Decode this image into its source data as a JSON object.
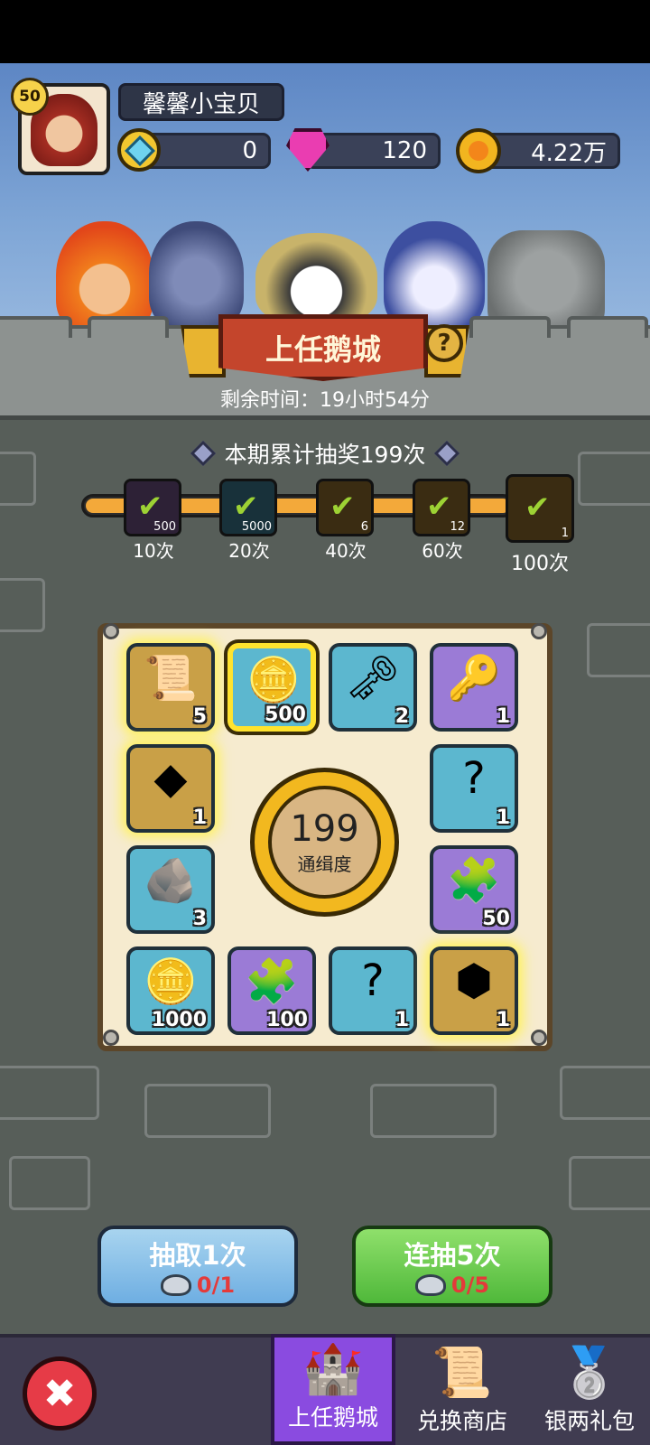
{
  "player": {
    "level": "50",
    "name": "馨馨小宝贝"
  },
  "currency": {
    "diamond": "0",
    "gem": "120",
    "gold": "4.22万"
  },
  "event": {
    "title": "上任鹅城",
    "help_icon": "?",
    "timer": "剩余时间：19小时54分"
  },
  "progress": {
    "total_text": "本期累计抽奖199次",
    "fill_fraction": 1.0,
    "milestones": [
      {
        "label": "10次",
        "count": "500"
      },
      {
        "label": "20次",
        "count": "5000"
      },
      {
        "label": "40次",
        "count": "6"
      },
      {
        "label": "60次",
        "count": "12"
      },
      {
        "label": "100次",
        "count": "1"
      }
    ]
  },
  "board": {
    "center": {
      "value": "199",
      "label": "通缉度"
    },
    "tiles": [
      {
        "icon": "scroll-icon",
        "glyph": "📜",
        "qty": "5",
        "color": "gold"
      },
      {
        "icon": "gold-coin-icon",
        "glyph": "🪙",
        "qty": "500",
        "color": "blue"
      },
      {
        "icon": "silver-key-icon",
        "glyph": "🗝",
        "qty": "2",
        "color": "blue"
      },
      {
        "icon": "gold-key-icon",
        "glyph": "🔑",
        "qty": "1",
        "color": "purple"
      },
      {
        "icon": "amber-gem-icon",
        "glyph": "◆",
        "qty": "1",
        "color": "gold"
      },
      {
        "icon": "mystery-banner-icon",
        "glyph": "?",
        "qty": "1",
        "color": "blue"
      },
      {
        "icon": "rune-stone-icon",
        "glyph": "🪨",
        "qty": "3",
        "color": "blue"
      },
      {
        "icon": "mystery-puzzle-icon",
        "glyph": "🧩",
        "qty": "50",
        "color": "purple"
      },
      {
        "icon": "gold-coin-icon",
        "glyph": "🪙",
        "qty": "1000",
        "color": "blue"
      },
      {
        "icon": "mystery-puzzle-icon",
        "glyph": "🧩",
        "qty": "100",
        "color": "purple"
      },
      {
        "icon": "mystery-banner-icon",
        "glyph": "?",
        "qty": "1",
        "color": "blue"
      },
      {
        "icon": "yellow-gem-icon",
        "glyph": "⬢",
        "qty": "1",
        "color": "gold"
      }
    ]
  },
  "actions": {
    "draw_one": {
      "label": "抽取1次",
      "cost": "0/1"
    },
    "draw_five": {
      "label": "连抽5次",
      "cost": "0/5"
    }
  },
  "nav": {
    "tab1": "上任鹅城",
    "tab2": "兑换商店",
    "tab3": "银两礼包",
    "close": "✖"
  }
}
